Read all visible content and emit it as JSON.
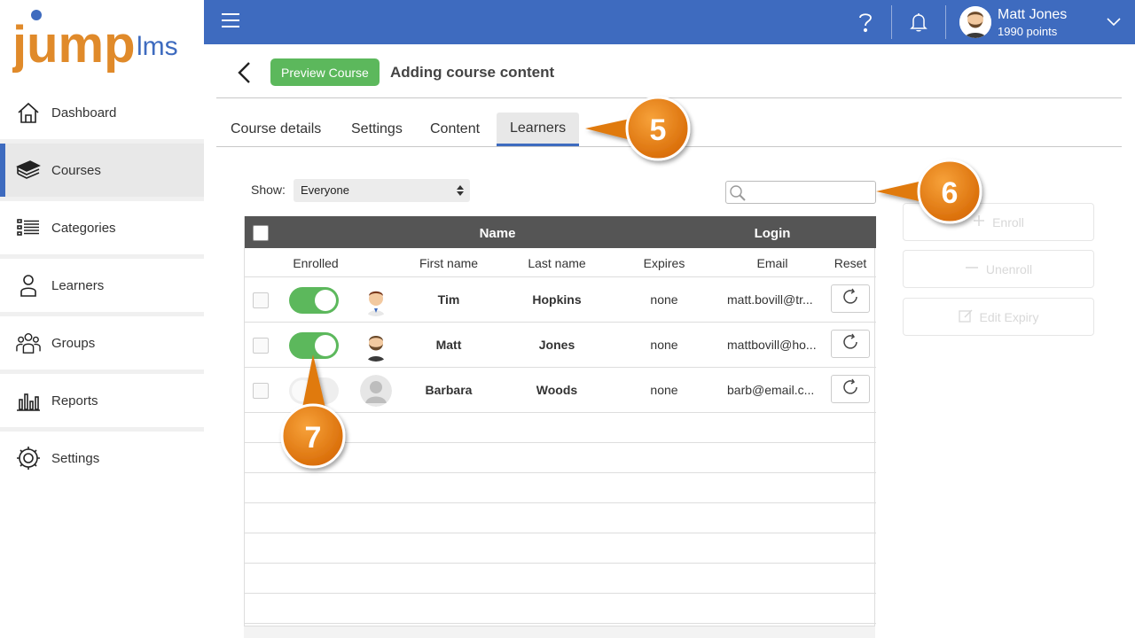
{
  "app": {
    "logo_main": "jump",
    "logo_sub": "lms"
  },
  "sidebar": {
    "items": [
      {
        "label": "Dashboard",
        "icon": "home-icon"
      },
      {
        "label": "Courses",
        "icon": "courses-icon"
      },
      {
        "label": "Categories",
        "icon": "list-icon"
      },
      {
        "label": "Learners",
        "icon": "person-icon"
      },
      {
        "label": "Groups",
        "icon": "groups-icon"
      },
      {
        "label": "Reports",
        "icon": "chart-icon"
      },
      {
        "label": "Settings",
        "icon": "gear-icon"
      }
    ],
    "active": "Courses"
  },
  "topbar": {
    "user_name": "Matt Jones",
    "user_points": "1990 points"
  },
  "page": {
    "preview_button": "Preview Course",
    "title": "Adding course content",
    "tabs": [
      "Course details",
      "Settings",
      "Content",
      "Learners"
    ],
    "active_tab": "Learners"
  },
  "filters": {
    "show_label": "Show:",
    "show_value": "Everyone"
  },
  "table": {
    "group_headers": {
      "name": "Name",
      "login": "Login"
    },
    "columns": [
      "Enrolled",
      "First name",
      "Last name",
      "Expires",
      "Email",
      "Reset"
    ],
    "rows": [
      {
        "enrolled": true,
        "first": "Tim",
        "last": "Hopkins",
        "expires": "none",
        "email": "matt.bovill@tr..."
      },
      {
        "enrolled": true,
        "first": "Matt",
        "last": "Jones",
        "expires": "none",
        "email": "mattbovill@ho..."
      },
      {
        "enrolled": false,
        "first": "Barbara",
        "last": "Woods",
        "expires": "none",
        "email": "barb@email.c..."
      }
    ]
  },
  "actions": {
    "enroll": "Enroll",
    "unenroll": "Unenroll",
    "edit_expiry": "Edit Expiry"
  },
  "callouts": [
    "5",
    "6",
    "7"
  ],
  "colors": {
    "brand_blue": "#3e6bbf",
    "green": "#5cb85c",
    "callout_orange": "#e07a10",
    "logo_orange": "#e08a2a",
    "header_grey": "#555555"
  }
}
